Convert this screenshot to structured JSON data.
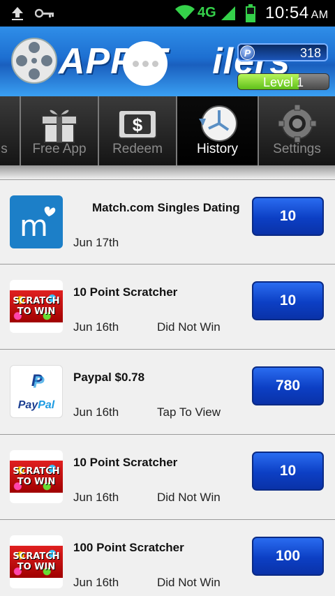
{
  "status_bar": {
    "network": "4G",
    "time": "10:54",
    "ampm": "AM"
  },
  "header": {
    "brand_text": "APP T",
    "brand_text_2": "ilers",
    "points": "318",
    "points_symbol": "P",
    "level_label": "Level 1",
    "level_progress": 0.67
  },
  "tabs": [
    {
      "label": "s"
    },
    {
      "label": "Free App"
    },
    {
      "label": "Redeem"
    },
    {
      "label": "History"
    },
    {
      "label": "Settings"
    }
  ],
  "history": [
    {
      "title": "Match.com Singles Dating",
      "date": "Jun 17th",
      "status": "",
      "value": "10",
      "icon": "match-logo-icon"
    },
    {
      "title": "10 Point Scratcher",
      "date": "Jun 16th",
      "status": "Did Not Win",
      "value": "10",
      "icon": "scratch-to-win-icon",
      "thumb_text": "SCRATCH TO WIN"
    },
    {
      "title": "Paypal $0.78",
      "date": "Jun 16th",
      "status": "Tap To View",
      "value": "780",
      "icon": "paypal-logo-icon",
      "thumb_pay": "Pay",
      "thumb_pal": "Pal"
    },
    {
      "title": "10 Point Scratcher",
      "date": "Jun 16th",
      "status": "Did Not Win",
      "value": "10",
      "icon": "scratch-to-win-icon",
      "thumb_text": "SCRATCH TO WIN"
    },
    {
      "title": "100 Point Scratcher",
      "date": "Jun 16th",
      "status": "Did Not Win",
      "value": "100",
      "icon": "scratch-to-win-icon",
      "thumb_text": "SCRATCH TO WIN"
    }
  ]
}
